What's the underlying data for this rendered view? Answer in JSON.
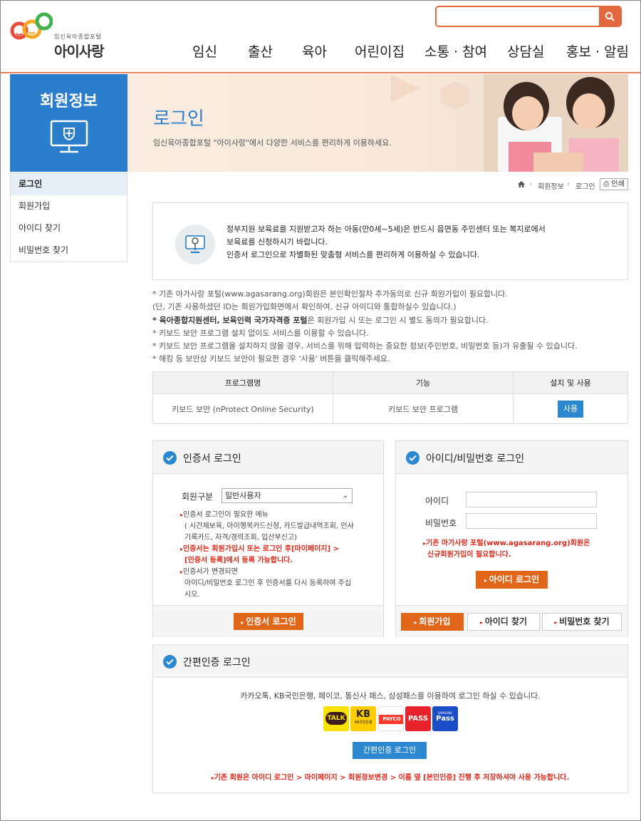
{
  "header": {
    "logo_sub": "임신육아종합포털",
    "logo_main": "아이사랑",
    "search_placeholder": ""
  },
  "gnb": [
    "임신",
    "출산",
    "육아",
    "어린이집",
    "소통 · 참여",
    "상담실",
    "홍보 · 알림"
  ],
  "lnb": {
    "title": "회원정보",
    "items": [
      "로그인",
      "회원가입",
      "아이디 찾기",
      "비밀번호 찾기"
    ]
  },
  "visual": {
    "title": "로그인",
    "desc": "임신육아종합포털 \"아이사랑\"에서 다양한 서비스를 편리하게 이용하세요."
  },
  "breadcrumb": [
    "회원정보",
    "로그인"
  ],
  "print_label": "인쇄",
  "notice": [
    "정부지원 보육료를 지원받고자 하는 아동(만0세~5세)은 반드시 읍면동 주민센터 또는 복지로에서",
    "보육료를 신청하시기 바랍니다.",
    "인증서 로그인으로 차별화된 맞춤형 서비스를 편리하게 이용하실 수 있습니다."
  ],
  "bullets": {
    "b1": "* 기존 아가사랑 포털(www.agasarang.org)회원은 본인확인절차 추가동의로 신규 회원가입이 필요합니다.",
    "b2": "(단, 기존 사용하셨던 ID는 회원가입화면에서 확인하여, 신규 아이디와 통합하실수 있습니다.)",
    "b3_bold": "* 육아종합지원센터, 보육인력 국가자격증 포털",
    "b3_rest": "은 회원가입 시 또는 로그인 시 별도 동의가 필요합니다.",
    "b4": "* 키보드 보안 프로그램 설치 없이도 서비스를 이용할 수 있습니다.",
    "b5": "* 키보드 보안 프로그램을 설치하지 않을 경우, 서비스를 위해 입력하는 중요한 정보(주민번호, 비밀번호 등)가 유출될 수 있습니다.",
    "b6": "* 해킹 등 보안상 키보드 보안이 필요한 경우 '사용' 버튼을 클릭해주세요."
  },
  "program_table": {
    "headers": [
      "프로그램명",
      "기능",
      "설치 및 사용"
    ],
    "row": {
      "name": "키보드 보안 (nProtect Online Security)",
      "func": "키보드 보안 프로그램",
      "btn": "사용"
    }
  },
  "cert_login": {
    "title": "인증서 로그인",
    "member_label": "회원구분",
    "member_value": "일반사용자",
    "n1": "인증서 로그인이 필요한 메뉴",
    "n1a": "( 시간제보육, 아이행복카드신청, 카드발급내역조회, 인사",
    "n1b": "기록카드, 자격/경력조회, 입산부신고)",
    "n2a": "인증서는 회원가입시 또는 로그인 후[마이페이지] >",
    "n2b": "[인증서 등록]에서 등록 가능합니다.",
    "n3": "인증서가 변경되면",
    "n3a": "아이디/비밀번호 로그인 후 인증서를 다시 등록하여 주십",
    "n3b": "시오.",
    "btn": "인증서 로그인"
  },
  "id_login": {
    "title": "아이디/비밀번호 로그인",
    "id_label": "아이디",
    "pw_label": "비밀번호",
    "note1": "기존 아가사랑 포털(www.agasarang.org)회원은",
    "note2": "신규회원가입이 필요합니다.",
    "btn": "아이디 로그인",
    "join": "회원가입",
    "find_id": "아이디 찾기",
    "find_pw": "비밀번호 찾기"
  },
  "easy_login": {
    "title": "간편인증 로그인",
    "desc": "카카오톡, KB국민은행, 페이코, 통신사 패스, 삼성패스를 이용하여 로그인 하실 수 있습니다.",
    "icons": [
      {
        "label": "TALK",
        "color": "#fae100"
      },
      {
        "label": "KB",
        "color": "#ffcc00"
      },
      {
        "label": "PAYCO",
        "color": "#ff3b30"
      },
      {
        "label": "PASS",
        "color": "#e8232b"
      },
      {
        "label": "Pass",
        "color": "#1b4dc7"
      }
    ],
    "kb_sub": "KB국민은행",
    "samsung_sub": "SAMSUNG",
    "btn": "간편인증 로그인",
    "footnote": "기존 회원은 아이디 로그인 > 마이페이지 > 회원정보변경 > 이름 옆 [본인인증] 진행 후 저장하셔야 사용 가능합니다."
  }
}
